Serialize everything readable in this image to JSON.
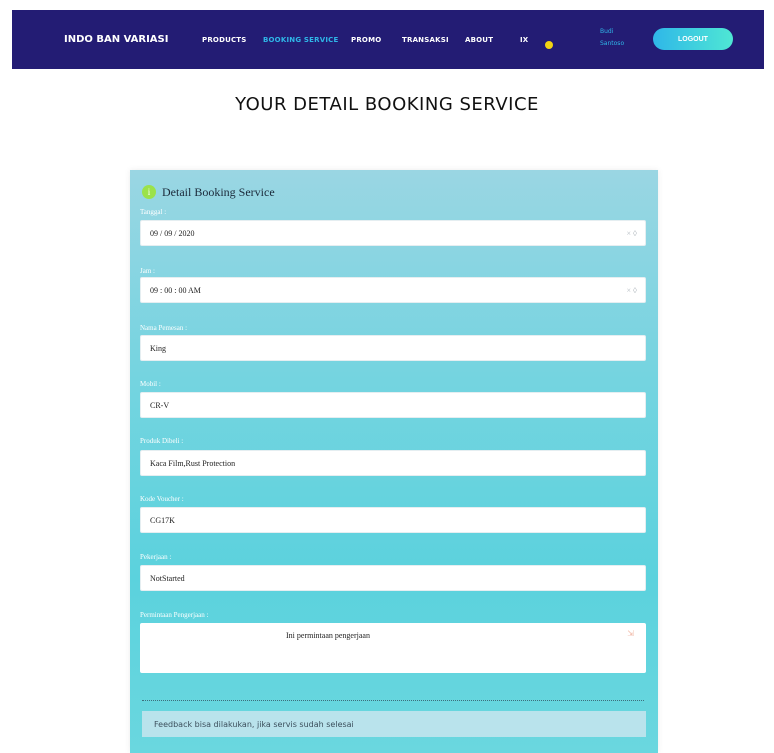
{
  "nav": {
    "brand": "INDO BAN VARIASI",
    "links": [
      "PRODUCTS",
      "BOOKING SERVICE",
      "PROMO",
      "TRANSAKSI",
      "ABOUT"
    ],
    "extra_label": "IX",
    "stack_line1": "Budi",
    "stack_line2": "Santoso",
    "logout": "LOGOUT",
    "icons": [
      "flag-icon",
      "sun-icon"
    ]
  },
  "page": {
    "title": "YOUR DETAIL BOOKING SERVICE"
  },
  "card": {
    "heading": "Detail Booking Service",
    "heading_icon": "i",
    "fields": [
      {
        "label": "Tanggal :",
        "value": "09 / 09 / 2020",
        "trail": "× ◊"
      },
      {
        "label": "Jam :",
        "value": "09 : 00 : 00   AM",
        "trail": "× ◊"
      },
      {
        "label": "Nama Pemesan :",
        "value": "King"
      },
      {
        "label": "Mobil :",
        "value": "CR-V"
      },
      {
        "label": "Produk Dibeli :",
        "value": "Kaca Film,Rust Protection"
      },
      {
        "label": "Kode Voucher :",
        "value": "CG17K"
      },
      {
        "label": "Pekerjaan :",
        "value": "NotStarted"
      }
    ],
    "request_label": "Permintaan Pengerjaan :",
    "request_value": "Ini permintaan pengerjaan",
    "request_resize": "⇲",
    "feedback": "Feedback bisa dilakukan, jika servis sudah selesai"
  },
  "colors": {
    "navbar": "#231c74",
    "accent": "#2fb7e8",
    "card_teal": "#5bd2dd",
    "logout_gradient_end": "#4fe7d4",
    "heading_icon": "#9be24b"
  }
}
